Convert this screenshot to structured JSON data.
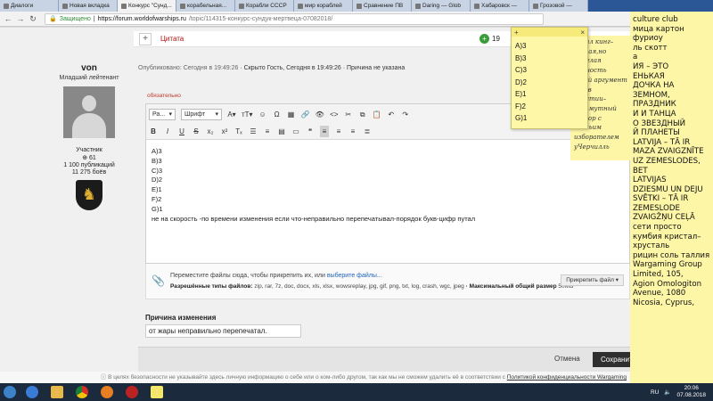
{
  "browser": {
    "tabs": [
      {
        "label": "Диалоги",
        "active": false
      },
      {
        "label": "Новая вкладка",
        "active": false
      },
      {
        "label": "Конкурс \"Сунд...",
        "active": true
      },
      {
        "label": "корабельная...",
        "active": false
      },
      {
        "label": "Корабли СССР",
        "active": false
      },
      {
        "label": "мир кораблей",
        "active": false
      },
      {
        "label": "Сравнение ПВ",
        "active": false
      },
      {
        "label": "Daring — Glob",
        "active": false
      },
      {
        "label": "Хабаровск —",
        "active": false
      },
      {
        "label": "Грозовой —",
        "active": false
      }
    ],
    "secure_label": "Защищено",
    "url_host": "https://forum.worldofwarships.ru",
    "url_path": "/topic/114315-конкурс-сундук-мертвеца-07082018/"
  },
  "post_bar": {
    "quote_label": "Цитата",
    "reputation": "19"
  },
  "author": {
    "name": "von",
    "rank": "Младший лейтенант",
    "group": "Участник",
    "reputation": "⊕ 61",
    "posts": "1 100 публикаций",
    "battles": "11 275 боёв"
  },
  "meta": {
    "posted": "Опубликовано: Сегодня в 19:49:26",
    "hidden": "· Скрыто Гость, Сегодня в 19:49:26",
    "reason": "· Причина не указана"
  },
  "editor": {
    "required_label": "обязательно",
    "format_select": "Ра...",
    "font_select": "Шрифт",
    "lines": [
      "A)3",
      "B)3",
      "C)3",
      "D)2",
      "E)1",
      "F)2",
      "G)1",
      "не на скорость -по времени изменения если что-неправильно перепечатывал-порядок букв-цифр путал"
    ]
  },
  "attach": {
    "hint": "Переместите файлы сюда, чтобы прикрепить их, или",
    "choose_link": "выберите файлы...",
    "types_label": "Разрешённые типы файлов:",
    "types": "zip, rar, 7z, doc, docx, xls, xlsx, wowsreplay, jpg, gif, png, txt, log, crash, wgc, jpeg",
    "max_label": "· Максимальный общий размер",
    "max_value": "50MB",
    "other_button": "Прикрепить файл ▾"
  },
  "edit_reason": {
    "label": "Причина изменения",
    "value": "от жары неправильно перепечатал."
  },
  "actions": {
    "cancel": "Отмена",
    "save": "Сохранить"
  },
  "privacy": {
    "text": "ⓘ В целях безопасности не указывайте здесь личную информацию о себе или о ком-либо другом, так как мы не сможем удалить её в соответствии с",
    "link": "Политикой конфиденциальности Wargaming"
  },
  "sticky_top": {
    "lines": [
      "A)3",
      "B)3",
      "C)3",
      "D)2",
      "E)1",
      "F)2",
      "G)1"
    ]
  },
  "sticky_mid": {
    "lines": [
      "вирал кинг–",
      "рговая,но",
      "мозглая личность",
      "шний аргумент",
      "ртив",
      "ократии–",
      "кальмутный",
      "вговор с овечьим",
      "изборателем",
      "уЧерчилль"
    ]
  },
  "sticky_right": {
    "lines": [
      "culture club",
      "мица картон",
      "фуриоу",
      "ль скотт",
      "а",
      "ИЯ – ЭТО",
      "ЕНЬКАЯ",
      "ДОЧКА НА",
      "ЗЕМНОМ,",
      "ПРАЗДНИК",
      "И И ТАНЦА",
      "О ЗВЕЗДНЫЙ",
      "Й ПЛАНЕТЫ",
      "LATVIJA – TĀ IR",
      "MAZA ZVAIGZNĪTE",
      "UZ ZEMESLODES,",
      "BET",
      "LATVIJAS",
      "DZIESMU UN DEJU",
      "SVĒTKI – TĀ IR",
      "ZEMESLODE",
      "ZVAIGŽŅU CEĻĀ",
      "сети просто",
      "кумбия кристал–",
      "хрусталь",
      "рицин соль таллия",
      "Wargaming Group",
      "Limited, 105,",
      "Agion Omologiton",
      "Avenue, 1080",
      "Nicosia, Cyprus,"
    ]
  },
  "taskbar": {
    "lang": "RU",
    "time": "20:06",
    "date": "07.08.2018"
  }
}
